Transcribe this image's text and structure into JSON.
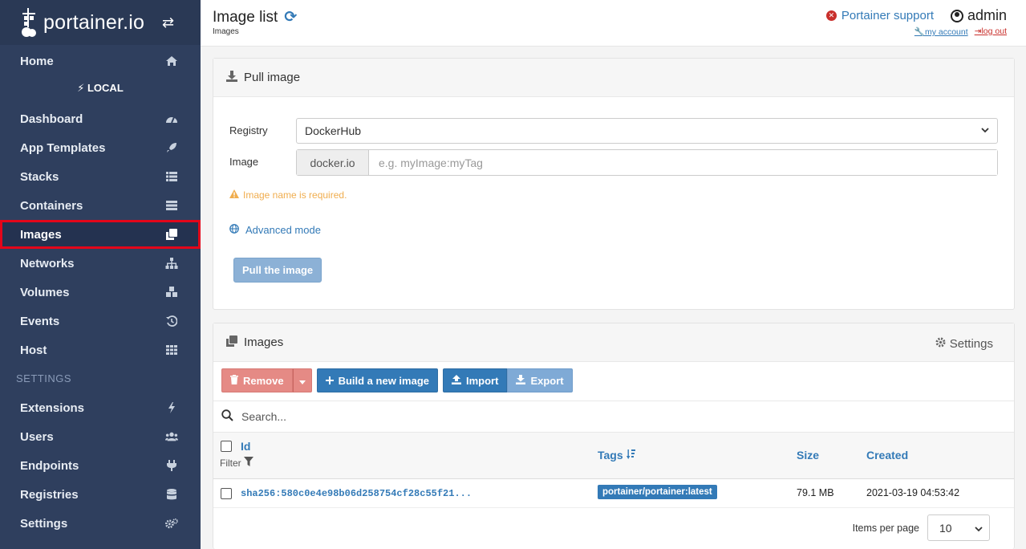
{
  "brand": {
    "name": "portainer.io"
  },
  "sidebar": {
    "endpoint": "LOCAL",
    "settings_section": "SETTINGS",
    "items": [
      {
        "label": "Home",
        "icon": "home-icon"
      },
      {
        "label": "Dashboard",
        "icon": "tachometer-icon"
      },
      {
        "label": "App Templates",
        "icon": "rocket-icon"
      },
      {
        "label": "Stacks",
        "icon": "th-list-icon"
      },
      {
        "label": "Containers",
        "icon": "server-icon"
      },
      {
        "label": "Images",
        "icon": "clone-icon"
      },
      {
        "label": "Networks",
        "icon": "sitemap-icon"
      },
      {
        "label": "Volumes",
        "icon": "cubes-icon"
      },
      {
        "label": "Events",
        "icon": "history-icon"
      },
      {
        "label": "Host",
        "icon": "th-icon"
      },
      {
        "label": "Extensions",
        "icon": "bolt-icon"
      },
      {
        "label": "Users",
        "icon": "users-icon"
      },
      {
        "label": "Endpoints",
        "icon": "plug-icon"
      },
      {
        "label": "Registries",
        "icon": "database-icon"
      },
      {
        "label": "Settings",
        "icon": "cogs-icon"
      }
    ]
  },
  "header": {
    "title": "Image list",
    "breadcrumb": "Images",
    "support": "Portainer support",
    "user": "admin",
    "my_account": "my account",
    "log_out": "log out"
  },
  "pull": {
    "title": "Pull image",
    "registry_label": "Registry",
    "registry_value": "DockerHub",
    "image_label": "Image",
    "image_prefix": "docker.io",
    "image_placeholder": "e.g. myImage:myTag",
    "warning": "Image name is required.",
    "advanced": "Advanced mode",
    "button": "Pull the image"
  },
  "images": {
    "title": "Images",
    "settings": "Settings",
    "remove": "Remove",
    "build": "Build a new image",
    "import": "Import",
    "export": "Export",
    "search_placeholder": "Search...",
    "columns": {
      "id": "Id",
      "filter": "Filter",
      "tags": "Tags",
      "size": "Size",
      "created": "Created"
    },
    "rows": [
      {
        "id": "sha256:580c0e4e98b06d258754cf28c55f21...",
        "tag": "portainer/portainer:latest",
        "size": "79.1 MB",
        "created": "2021-03-19 04:53:42"
      }
    ],
    "items_per_page_label": "Items per page",
    "items_per_page": "10"
  },
  "colors": {
    "sidebar": "#2f3f5e",
    "primary": "#337ab7",
    "danger": "#e58a85",
    "warning": "#f0ad4e",
    "highlight": "#e3061a"
  }
}
